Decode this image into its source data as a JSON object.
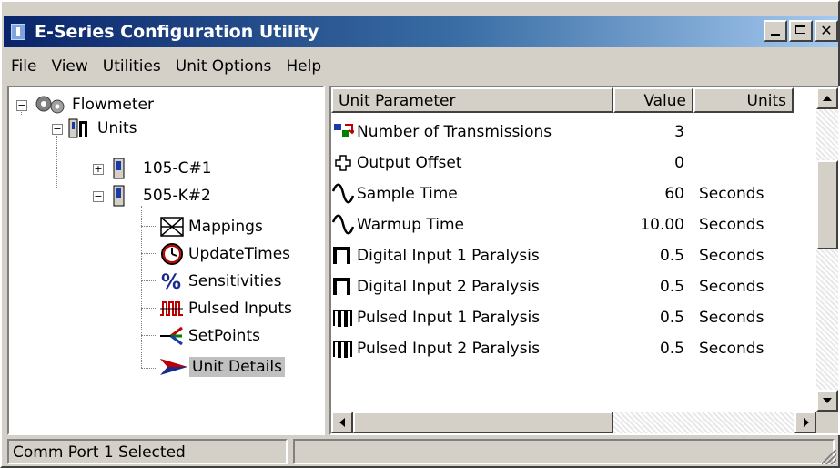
{
  "window": {
    "title": "E-Series Configuration Utility"
  },
  "menu": [
    {
      "label": "File"
    },
    {
      "label": "View"
    },
    {
      "label": "Utilities"
    },
    {
      "label": "Unit Options"
    },
    {
      "label": "Help"
    }
  ],
  "tree": {
    "root": "Flowmeter",
    "units": "Units",
    "unit1": "105-C#1",
    "unit2": "505-K#2",
    "children": [
      "Mappings",
      "UpdateTimes",
      "Sensitivities",
      "Pulsed Inputs",
      "SetPoints",
      "Unit Details"
    ],
    "selected": "Unit Details"
  },
  "table": {
    "headers": [
      "Unit Parameter",
      "Value",
      "Units"
    ],
    "rows": [
      {
        "param": "Number of Transmissions",
        "value": "3",
        "units": "",
        "icon": "transmission-icon"
      },
      {
        "param": "Output Offset",
        "value": "0",
        "units": "",
        "icon": "offset-cross-icon"
      },
      {
        "param": "Sample Time",
        "value": "60",
        "units": "Seconds",
        "icon": "sine-wave-icon"
      },
      {
        "param": "Warmup Time",
        "value": "10.00",
        "units": "Seconds",
        "icon": "sine-wave-icon"
      },
      {
        "param": "Digital Input 1 Paralysis",
        "value": "0.5",
        "units": "Seconds",
        "icon": "square-pulse-icon"
      },
      {
        "param": "Digital Input 2 Paralysis",
        "value": "0.5",
        "units": "Seconds",
        "icon": "square-pulse-icon"
      },
      {
        "param": "Pulsed Input 1 Paralysis",
        "value": "0.5",
        "units": "Seconds",
        "icon": "pulse-train-icon"
      },
      {
        "param": "Pulsed Input 2 Paralysis",
        "value": "0.5",
        "units": "Seconds",
        "icon": "pulse-train-icon"
      }
    ]
  },
  "status": {
    "text": "Comm Port 1 Selected"
  },
  "colors": {
    "title_start": "#0a246a",
    "title_end": "#a6caf0",
    "chrome": "#d4d0c8"
  }
}
